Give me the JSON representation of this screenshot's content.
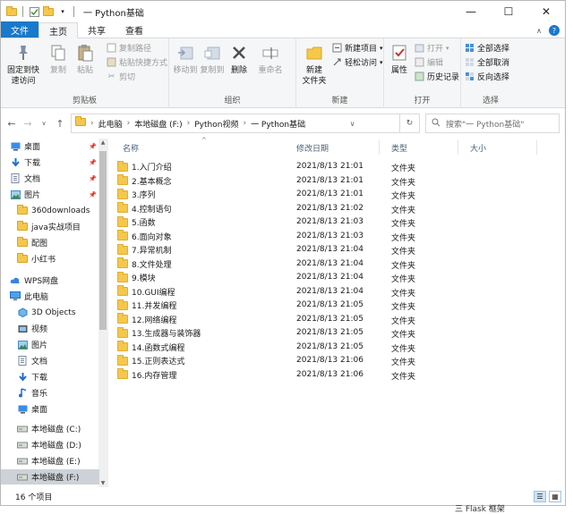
{
  "window": {
    "title": "一 Python基础"
  },
  "ribbon_tabs": [
    "文件",
    "主页",
    "共享",
    "查看"
  ],
  "groups": {
    "clipboard": {
      "label": "剪贴板",
      "pin": "固定到快\n速访问",
      "copy": "复制",
      "paste": "粘贴",
      "copy_path": "复制路径",
      "paste_shortcut": "粘贴快捷方式",
      "cut": "剪切"
    },
    "organize": {
      "label": "组织",
      "move_to": "移动到",
      "copy_to": "复制到",
      "delete": "删除",
      "rename": "重命名"
    },
    "new": {
      "label": "新建",
      "new_folder": "新建\n文件夹",
      "new_item": "新建项目",
      "easy_access": "轻松访问"
    },
    "open": {
      "label": "打开",
      "properties": "属性",
      "open": "打开",
      "edit": "编辑",
      "history": "历史记录"
    },
    "select": {
      "label": "选择",
      "select_all": "全部选择",
      "select_none": "全部取消",
      "invert": "反向选择"
    }
  },
  "address": {
    "crumbs": [
      "此电脑",
      "本地磁盘 (F:)",
      "Python视频",
      "一 Python基础"
    ],
    "search_placeholder": "搜索\"一 Python基础\""
  },
  "nav": [
    {
      "label": "桌面",
      "icon": "desktop-icon",
      "pinned": true
    },
    {
      "label": "下载",
      "icon": "download-icon",
      "pinned": true
    },
    {
      "label": "文档",
      "icon": "document-icon",
      "pinned": true
    },
    {
      "label": "图片",
      "icon": "picture-icon",
      "pinned": true
    },
    {
      "label": "360downloads",
      "icon": "folder-icon",
      "pinned": false
    },
    {
      "label": "java实战项目",
      "icon": "folder-icon",
      "pinned": false
    },
    {
      "label": "配图",
      "icon": "folder-icon",
      "pinned": false
    },
    {
      "label": "小红书",
      "icon": "folder-icon",
      "pinned": false
    },
    {
      "label": "WPS网盘",
      "icon": "cloud-icon",
      "pinned": false
    },
    {
      "label": "此电脑",
      "icon": "computer-icon",
      "pinned": false
    },
    {
      "label": "3D Objects",
      "icon": "3d-objects-icon",
      "pinned": false
    },
    {
      "label": "视频",
      "icon": "video-icon",
      "pinned": false
    },
    {
      "label": "图片",
      "icon": "picture-icon",
      "pinned": false
    },
    {
      "label": "文档",
      "icon": "document-icon",
      "pinned": false
    },
    {
      "label": "下载",
      "icon": "download-icon",
      "pinned": false
    },
    {
      "label": "音乐",
      "icon": "music-icon",
      "pinned": false
    },
    {
      "label": "桌面",
      "icon": "desktop-icon",
      "pinned": false
    },
    {
      "label": "本地磁盘 (C:)",
      "icon": "drive-icon",
      "pinned": false
    },
    {
      "label": "本地磁盘 (D:)",
      "icon": "drive-icon",
      "pinned": false
    },
    {
      "label": "本地磁盘 (E:)",
      "icon": "drive-icon",
      "pinned": false
    },
    {
      "label": "本地磁盘 (F:)",
      "icon": "drive-icon",
      "pinned": false,
      "selected": true
    }
  ],
  "columns": {
    "name": "名称",
    "modified": "修改日期",
    "type": "类型",
    "size": "大小"
  },
  "files": [
    {
      "name": "1.入门介绍",
      "modified": "2021/8/13 21:01",
      "type": "文件夹"
    },
    {
      "name": "2.基本概念",
      "modified": "2021/8/13 21:01",
      "type": "文件夹"
    },
    {
      "name": "3.序列",
      "modified": "2021/8/13 21:01",
      "type": "文件夹"
    },
    {
      "name": "4.控制语句",
      "modified": "2021/8/13 21:02",
      "type": "文件夹"
    },
    {
      "name": "5.函数",
      "modified": "2021/8/13 21:03",
      "type": "文件夹"
    },
    {
      "name": "6.面向对象",
      "modified": "2021/8/13 21:03",
      "type": "文件夹"
    },
    {
      "name": "7.异常机制",
      "modified": "2021/8/13 21:04",
      "type": "文件夹"
    },
    {
      "name": "8.文件处理",
      "modified": "2021/8/13 21:04",
      "type": "文件夹"
    },
    {
      "name": "9.模块",
      "modified": "2021/8/13 21:04",
      "type": "文件夹"
    },
    {
      "name": "10.GUI编程",
      "modified": "2021/8/13 21:04",
      "type": "文件夹"
    },
    {
      "name": "11.并发编程",
      "modified": "2021/8/13 21:05",
      "type": "文件夹"
    },
    {
      "name": "12.网络编程",
      "modified": "2021/8/13 21:05",
      "type": "文件夹"
    },
    {
      "name": "13.生成器与装饰器",
      "modified": "2021/8/13 21:05",
      "type": "文件夹"
    },
    {
      "name": "14.函数式编程",
      "modified": "2021/8/13 21:05",
      "type": "文件夹"
    },
    {
      "name": "15.正则表达式",
      "modified": "2021/8/13 21:06",
      "type": "文件夹"
    },
    {
      "name": "16.内存管理",
      "modified": "2021/8/13 21:06",
      "type": "文件夹"
    }
  ],
  "status": {
    "count": "16 个项目"
  },
  "behind_text": "三 Flask 框架"
}
